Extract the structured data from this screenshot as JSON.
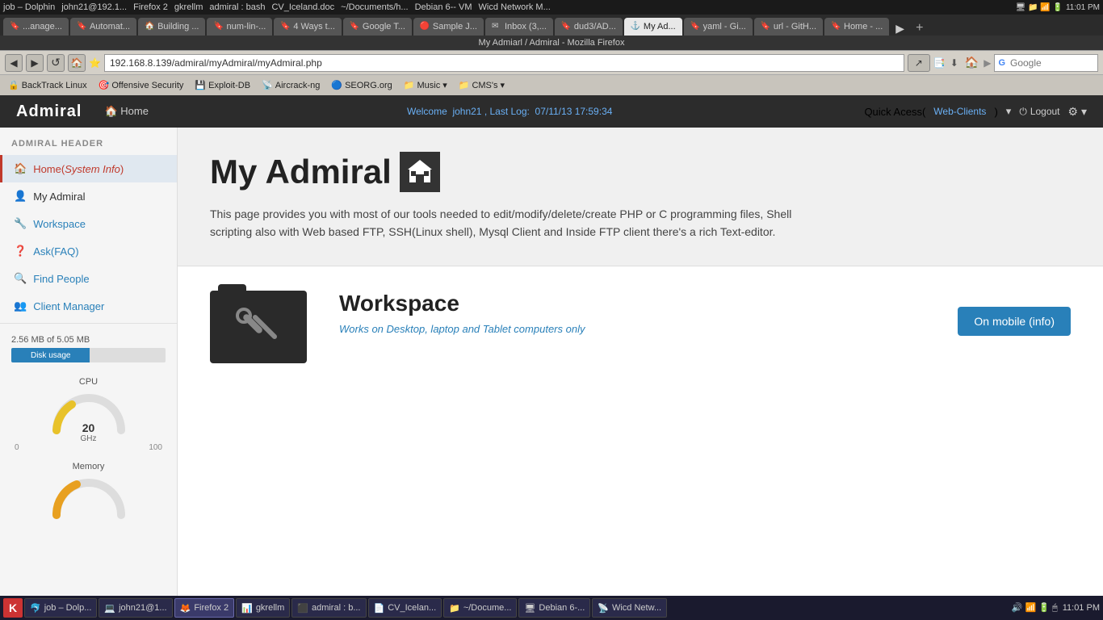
{
  "os_topbar": {
    "left_items": [
      "job – Dolphin",
      "john21@192.1...",
      "Firefox 2",
      "gkrellm",
      "admiral : bash",
      "CV_Iceland.doc",
      "~/Documents/h...",
      "Debian 6-- VM",
      "Wicd Network M..."
    ],
    "right_icons": [
      "monitor",
      "folder",
      "network",
      "battery",
      "clock"
    ]
  },
  "browser": {
    "title": "My Admiarl / Admiral - Mozilla Firefox",
    "tabs": [
      {
        "label": "...anage...",
        "active": false,
        "favicon": "🔖"
      },
      {
        "label": "Automat...",
        "active": false,
        "favicon": "🔖"
      },
      {
        "label": "Building ...",
        "active": false,
        "favicon": "🏠"
      },
      {
        "label": "num-lin-...",
        "active": false,
        "favicon": "🔖"
      },
      {
        "label": "4 Ways t...",
        "active": false,
        "favicon": "🔖"
      },
      {
        "label": "Google T...",
        "active": false,
        "favicon": "🔖"
      },
      {
        "label": "Sample J...",
        "active": false,
        "favicon": "🔴"
      },
      {
        "label": "Inbox (3,...",
        "active": false,
        "favicon": "✉"
      },
      {
        "label": "dud3/AD...",
        "active": false,
        "favicon": "🔖"
      },
      {
        "label": "My Ad...",
        "active": true,
        "favicon": "⚓"
      },
      {
        "label": "yaml - Gi...",
        "active": false,
        "favicon": "🔖"
      },
      {
        "label": "url - GitH...",
        "active": false,
        "favicon": "🔖"
      },
      {
        "label": "Home - ...",
        "active": false,
        "favicon": "🔖"
      }
    ],
    "url": "192.168.8.139/admiral/myAdmiral/myAdmiral.php",
    "search_placeholder": "Google",
    "bookmarks": [
      {
        "label": "BackTrack Linux"
      },
      {
        "label": "Offensive Security"
      },
      {
        "label": "Exploit-DB"
      },
      {
        "label": "Aircrack-ng"
      },
      {
        "label": "SEORG.org"
      },
      {
        "label": "Music"
      },
      {
        "label": "CMS's"
      }
    ]
  },
  "app": {
    "logo": "Admiral",
    "nav": [
      {
        "label": "🏠 Home"
      }
    ],
    "header": {
      "welcome": "Welcome",
      "username": "john21",
      "last_log_label": ", Last Log:",
      "last_log": "07/11/13 17:59:34",
      "quick_access_label": "Quick Acess(",
      "quick_access_link": "Web-Clients",
      "quick_access_end": ")",
      "logout": "Logout",
      "settings": "⚙"
    }
  },
  "sidebar": {
    "header": "ADMIRAL HEADER",
    "items": [
      {
        "label": "Home(System Info)",
        "icon": "🏠",
        "type": "active"
      },
      {
        "label": "My Admiral",
        "icon": "👤",
        "type": "normal"
      },
      {
        "label": "Workspace",
        "icon": "🔧",
        "type": "link"
      },
      {
        "label": "Ask(FAQ)",
        "icon": "❓",
        "type": "link"
      },
      {
        "label": "Find People",
        "icon": "🔍",
        "type": "link"
      },
      {
        "label": "Client Manager",
        "icon": "👥",
        "type": "link"
      }
    ],
    "disk_usage": {
      "label": "2.56 MB of 5.05 MB",
      "bar_label": "Disk usage",
      "percent": 51
    },
    "cpu": {
      "label": "CPU",
      "value": "20",
      "unit": "GHz",
      "min": "0",
      "max": "100",
      "percent": 20
    },
    "memory": {
      "label": "Memory"
    }
  },
  "content": {
    "hero": {
      "title": "My Admiral",
      "description_1": "This page provides you with most of our tools needed to edit/modify/delete/create PHP or C programming files, Shell",
      "description_2": "scripting also with Web based FTP, SSH(Linux shell), Mysql Client and Inside FTP client there's a rich Text-editor."
    },
    "workspace": {
      "title": "Workspace",
      "subtitle": "Works on Desktop, laptop and Tablet computers only",
      "folder_icon": "🔧"
    },
    "mobile_btn": "On mobile (info)"
  },
  "taskbar": {
    "start": "K",
    "items": [
      {
        "label": "job – Dolp...",
        "active": false
      },
      {
        "label": "john21@1...",
        "active": false
      },
      {
        "label": "Firefox",
        "active": true,
        "count": "2"
      },
      {
        "label": "gkrellm",
        "active": false
      },
      {
        "label": "admiral : b...",
        "active": false
      },
      {
        "label": "CV_Icelan...",
        "active": false
      },
      {
        "label": "~/Docume...",
        "active": false
      },
      {
        "label": "Debian 6-...",
        "active": false
      },
      {
        "label": "Wicd Netw...",
        "active": false
      }
    ],
    "clock": "11:01 PM",
    "iceland": "Iceland"
  }
}
